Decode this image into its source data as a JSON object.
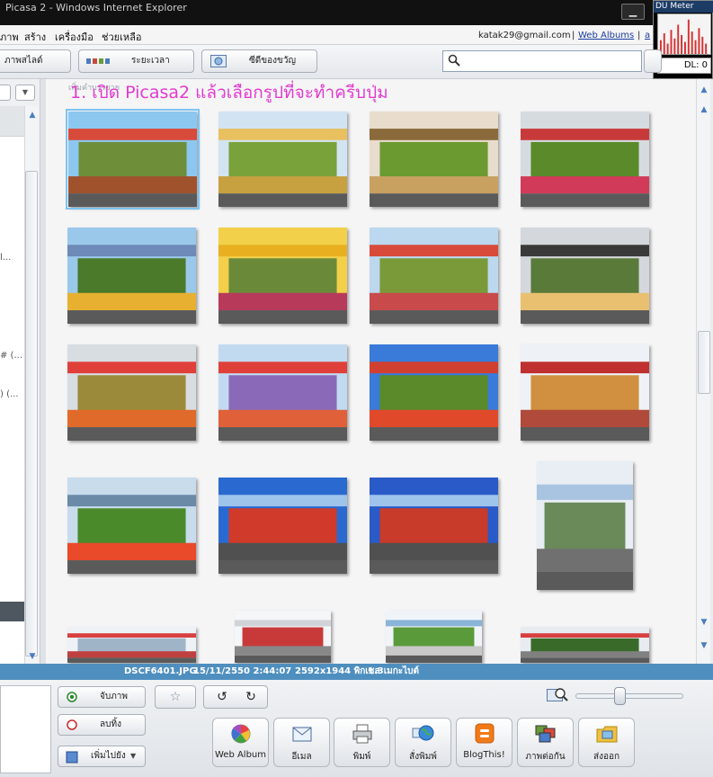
{
  "window": {
    "title": "Picasa 2 - Windows Internet Explorer",
    "dumeter_title": "DU Meter",
    "dumeter_label": "DL: 0"
  },
  "menu": {
    "items": [
      "ภาพ",
      "สร้าง",
      "เครื่องมือ",
      "ช่วยเหลือ"
    ],
    "account_email": "katak29@gmail.com",
    "separator": "|",
    "web_albums": "Web Albums",
    "extra_link": "a"
  },
  "toolbar": {
    "slideshow": "ภาพสไลด์",
    "timeline": "ระยะเวลา",
    "gift_cd": "ซีดีของขวัญ",
    "search_placeholder": ""
  },
  "main": {
    "instruction": "1. เปิด Picasa2 แล้วเลือกรูปที่จะทำครีบปุ่ม",
    "ghost_label": "เพิ่มคำบรรยาย",
    "thumbnails": [
      {
        "sky": "#8cc7f0",
        "top": "#d84a3a",
        "mid": "#6e8e3a",
        "low": "#a0522d",
        "selected": true
      },
      {
        "sky": "#d2e4f2",
        "top": "#e8c060",
        "mid": "#7aa23a",
        "low": "#c7a040",
        "selected": false
      },
      {
        "sky": "#e8dccc",
        "top": "#8a6a3a",
        "mid": "#6a9a30",
        "low": "#c8a060",
        "selected": false
      },
      {
        "sky": "#d6dbe0",
        "top": "#c83a3a",
        "mid": "#5a8a2a",
        "low": "#d23a5a",
        "selected": false
      },
      {
        "sky": "#9ac8ea",
        "top": "#6e8ab8",
        "mid": "#4a7a2a",
        "low": "#e8b030",
        "selected": false
      },
      {
        "sky": "#f2d04a",
        "top": "#e8b020",
        "mid": "#6a8a3a",
        "low": "#b83a5a",
        "selected": false
      },
      {
        "sky": "#bcd8ee",
        "top": "#d84a3a",
        "mid": "#7a9a3a",
        "low": "#c84a4a",
        "selected": false
      },
      {
        "sky": "#d4d8dc",
        "top": "#3a3a3a",
        "mid": "#5a7a3a",
        "low": "#e8c070",
        "selected": false
      },
      {
        "sky": "#d8dde2",
        "top": "#e0403a",
        "mid": "#9a8a3a",
        "low": "#e06a2a",
        "selected": false
      },
      {
        "sky": "#c2daf0",
        "top": "#e0403a",
        "mid": "#8a6ab8",
        "low": "#e0603a",
        "selected": false
      },
      {
        "sky": "#3a7ad8",
        "top": "#d04030",
        "mid": "#5a8a2a",
        "low": "#e04a2a",
        "selected": false
      },
      {
        "sky": "#eef2f6",
        "top": "#c03030",
        "mid": "#d09040",
        "low": "#b04a3a",
        "selected": false
      },
      {
        "sky": "#c8dcec",
        "top": "#6a8aa8",
        "mid": "#4a8a2a",
        "low": "#e84a2a",
        "selected": false
      },
      {
        "sky": "#2a6ad0",
        "top": "#9ec4ec",
        "mid": "#d03a2a",
        "low": "#505050",
        "selected": false
      },
      {
        "sky": "#2a5ac8",
        "top": "#9ec4ec",
        "mid": "#c83a2a",
        "low": "#505050",
        "selected": false
      },
      {
        "sky": "#e8eef4",
        "top": "#a8c4e0",
        "mid": "#6a8a5a",
        "low": "#707070",
        "selected": false
      },
      {
        "sky": "#eef2f6",
        "top": "#d84040",
        "mid": "#a0b4c8",
        "low": "#c04040",
        "selected": false
      },
      {
        "sky": "#f4f6f8",
        "top": "#d0d4d8",
        "mid": "#c83a3a",
        "low": "#888888",
        "selected": false
      },
      {
        "sky": "#f0f4f8",
        "top": "#8ab4d8",
        "mid": "#5a9a3a",
        "low": "#c8c8c8",
        "selected": false
      },
      {
        "sky": "#e8ecf0",
        "top": "#d84040",
        "mid": "#3a6a2a",
        "low": "#808080",
        "selected": false
      }
    ]
  },
  "leftpanel": {
    "frag1": "l...",
    "frag2": "# (...",
    "frag3": ") (..."
  },
  "info": {
    "filename": "DSCF6401.JPG",
    "datetime": "15/11/2550 2:44:07",
    "dimensions": "2592x1944 พิกเซล",
    "filesize": "1.3เมกะไบต์"
  },
  "bottom": {
    "hold": "จับภาพ",
    "clear": "ลบทิ้ง",
    "add_to": "เพิ่มไปยัง",
    "actions": [
      "Web Album",
      "อีเมล",
      "พิมพ์",
      "สั่งพิมพ์",
      "BlogThis!",
      "ภาพต่อกัน",
      "ส่งออก"
    ],
    "zoom_level": 0.4
  }
}
